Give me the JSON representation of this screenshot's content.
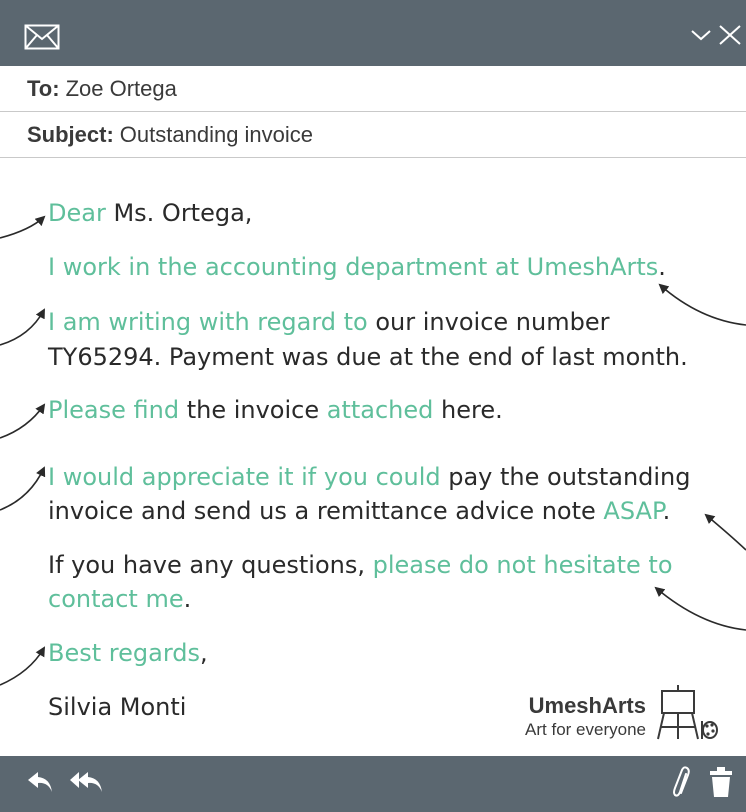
{
  "header": {
    "icon": "envelope-icon",
    "controls": [
      "chevron-down-icon",
      "close-icon"
    ]
  },
  "email": {
    "to_label": "To:",
    "to_value": "Zoe Ortega",
    "subject_label": "Subject:",
    "subject_value": "Outstanding invoice",
    "lines": {
      "l1a": "Dear",
      "l1b": " Ms. Ortega,",
      "l2a": "I work in the accounting department at UmeshArts",
      "l2b": ".",
      "l3a": "I am writing with regard to",
      "l3b": " our invoice number",
      "l4": "TY65294. Payment was due at the end of last month.",
      "l5a": "Please find",
      "l5b": " the invoice ",
      "l5c": "attached",
      "l5d": " here.",
      "l6a": "I would appreciate it if you could",
      "l6b": " pay the outstanding",
      "l7a": "invoice and send us a remittance advice note ",
      "l7b": "ASAP",
      "l7c": ".",
      "l8a": "If you have any questions, ",
      "l8b": "please do not hesitate to",
      "l9a": "contact me",
      "l9b": ".",
      "l10a": "Best regards",
      "l10b": ",",
      "l11": "Silvia Monti"
    }
  },
  "brand": {
    "name": "UmeshArts",
    "tagline": "Art for everyone",
    "icon": "easel-icon"
  },
  "footer": {
    "left_icons": [
      "reply-icon",
      "reply-all-icon"
    ],
    "right_icons": [
      "paperclip-icon",
      "trash-icon"
    ]
  },
  "colors": {
    "bar": "#5b6770",
    "highlight": "#5fbf9b",
    "text": "#2a2a2a"
  }
}
